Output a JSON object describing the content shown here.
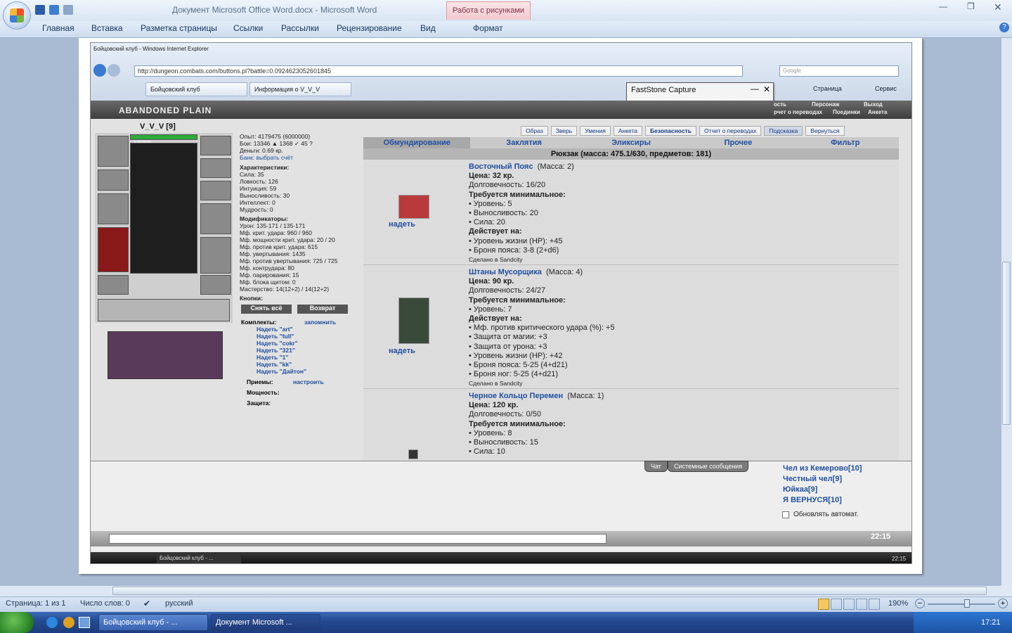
{
  "word": {
    "title": "Документ Microsoft Office Word.docx - Microsoft Word",
    "context_tab": "Работа с рисунками",
    "tabs": [
      "Главная",
      "Вставка",
      "Разметка страницы",
      "Ссылки",
      "Рассылки",
      "Рецензирование",
      "Вид"
    ],
    "format_tab": "Формат",
    "status": {
      "page": "Страница: 1 из 1",
      "words": "Число слов: 0",
      "lang": "русский",
      "zoom": "190%"
    }
  },
  "taskbar": {
    "btn1": "Бойцовский клуб - ...",
    "btn2": "Документ Microsoft ...",
    "clock": "17:21"
  },
  "ie": {
    "title": "Бойцовский клуб - Windows Internet Explorer",
    "url": "http://dungeon.combats.com/buttons.pl?battle=0.0924623052601845",
    "search_placeholder": "Google",
    "tab1": "Бойцовский клуб",
    "tab2": "Информация о V_V_V",
    "menu_page": "Страница",
    "menu_service": "Сервис"
  },
  "fastone": {
    "title": "FastStone Capture"
  },
  "game": {
    "location": "ABANDONED PLAIN",
    "nav_right": [
      "ость",
      "Персонаж",
      "Выход"
    ],
    "nav_right2": [
      "рчет о переводах",
      "Поединки",
      "Анкета"
    ],
    "char_name": "V_V_V [9]",
    "hp": "926/926",
    "stats": [
      "Опыт: 4179475 (6000000)",
      "Бои: 13346 ▲ 1368 ✓ 45 ?",
      "Деньги: 0.69 кр.",
      "Банк: выбрать счёт",
      "Характеристики:",
      "Сила: 35",
      "Ловкость: 126",
      "Интуиция: 59",
      "Выносливость: 30",
      "Интеллект: 0",
      "Мудрость: 0",
      "Модификаторы:",
      "Урон: 135-171 / 135-171",
      "Мф. крит. удара: 960 / 960",
      "Мф. мощности крит. удара: 20 / 20",
      "Мф. против крит. удара: 615",
      "Мф. увертывания: 1435",
      "Мф. против увертывания: 725 / 725",
      "Мф. контрудара: 80",
      "Мф. парирования: 15",
      "Мф. блока щитом: 0",
      "Мастерство: 14(12+2) / 14(12+2)",
      "Кнопки:"
    ],
    "btn_remove_all": "Снять всё",
    "btn_return": "Возврат",
    "sets_header": "Комплекты:",
    "sets_remember": "запомнить",
    "sets": [
      "Надеть \"art\"",
      "Надеть \"full\"",
      "Надеть \"cokr\"",
      "Надеть \"321\"",
      "Надеть \"1\"",
      "Надеть \"kk\"",
      "Надеть \"Дайтон\""
    ],
    "tricks": "Приемы:",
    "tricks_setup": "настроить",
    "power": "Мощность:",
    "defense": "Защита:",
    "top_tabs": [
      "Образ",
      "Зверь",
      "Умения",
      "Анкета",
      "Безопасность",
      "Отчет о переводах",
      "Подсказка",
      "Вернуться"
    ],
    "categories": [
      "Обмундирование",
      "Заклятия",
      "Эликсиры",
      "Прочее",
      "Фильтр"
    ],
    "rucksack": "Рюкзак (масса: 475.1/630, предметов: 181)",
    "wear_label": "надеть",
    "items": [
      {
        "name": "Восточный Пояс",
        "mass": "(Масса: 2)",
        "price": "Цена: 32 кр.",
        "durability": "Долговечность: 16/20",
        "req_head": "Требуется минимальное:",
        "reqs": [
          "• Уровень: 5",
          "• Выносливость: 20",
          "• Сила: 20"
        ],
        "eff_head": "Действует на:",
        "effects": [
          "• Уровень жизни (HP): +45",
          "• Броня пояса: 3-8 (2+d6)"
        ],
        "made": "Сделано в Sandcity"
      },
      {
        "name": "Штаны Мусорщика",
        "mass": "(Масса: 4)",
        "price": "Цена: 90 кр.",
        "durability": "Долговечность: 24/27",
        "req_head": "Требуется минимальное:",
        "reqs": [
          "• Уровень: 7"
        ],
        "eff_head": "Действует на:",
        "effects": [
          "• Мф. против критического удара (%): +5",
          "• Защита от магии: +3",
          "• Защита от урона: +3",
          "• Уровень жизни (HP): +42",
          "• Броня пояса: 5-25 (4+d21)",
          "• Броня ног: 5-25 (4+d21)"
        ],
        "made": "Сделано в Sandcity"
      },
      {
        "name": "Черное Кольцо Перемен",
        "mass": "(Масса: 1)",
        "price": "Цена: 120 кр.",
        "durability": "Долговечность: 0/50",
        "req_head": "Требуется минимальное:",
        "reqs": [
          "• Уровень: 8",
          "• Выносливость: 15",
          "• Сила: 10"
        ]
      }
    ],
    "chat_tabs": [
      "Чат",
      "Системные сообщения"
    ],
    "users": [
      "Чел из Кемерово[10]",
      "Честный чел[9]",
      "Юйкаа[9]",
      "Я ВЕРНУСЯ[10]"
    ],
    "auto_refresh": "Обновлять автомат.",
    "game_clock": "22:15",
    "inner_taskbar_btn": "Бойцовский клуб - ...",
    "inner_clock": "22:15"
  },
  "colors": {
    "link": "#1f4fa0",
    "ribbon": "#cddcee",
    "taskbar": "#24498f"
  }
}
